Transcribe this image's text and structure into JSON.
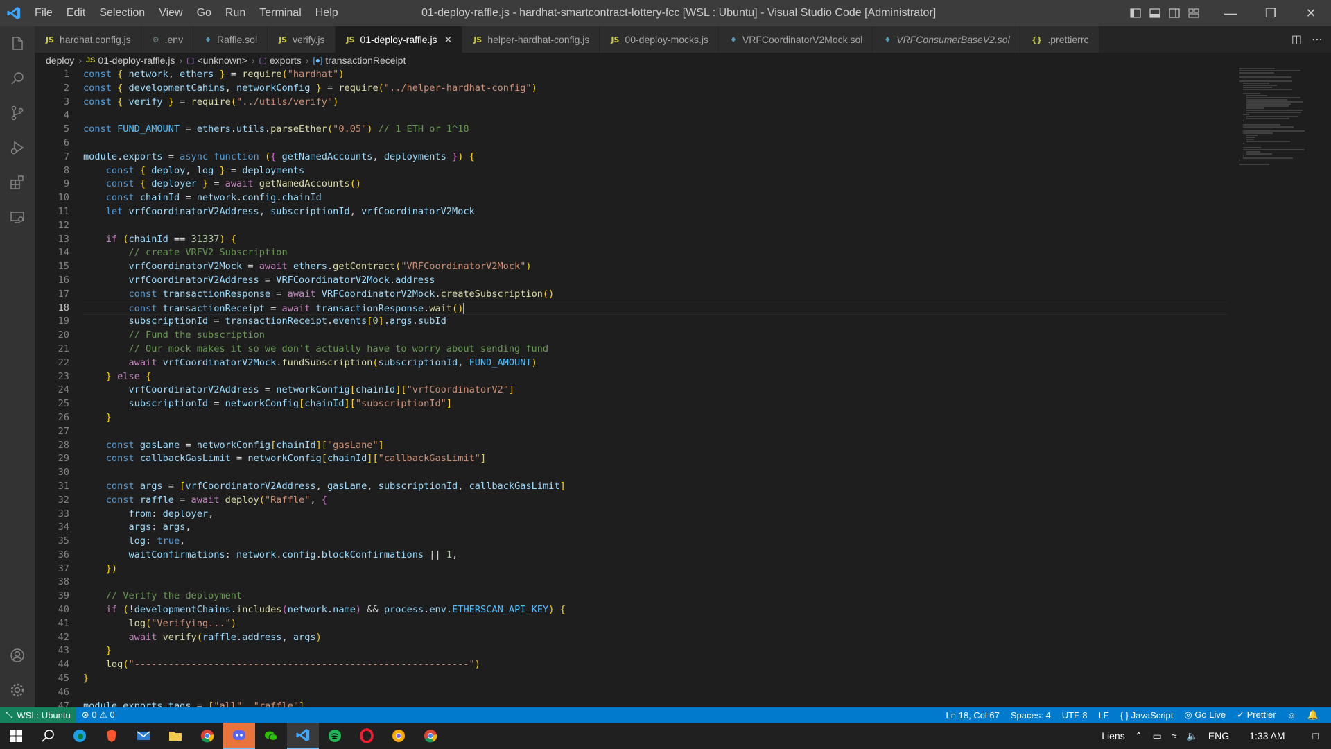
{
  "window": {
    "title": "01-deploy-raffle.js - hardhat-smartcontract-lottery-fcc [WSL : Ubuntu] - Visual Studio Code [Administrator]",
    "menus": [
      "File",
      "Edit",
      "Selection",
      "View",
      "Go",
      "Run",
      "Terminal",
      "Help"
    ]
  },
  "tabs": [
    {
      "icon": "JS",
      "label": "hardhat.config.js",
      "icon_color": "#cbcb41"
    },
    {
      "icon": "⚙",
      "label": ".env",
      "icon_color": "#6d8086"
    },
    {
      "icon": "♦",
      "label": "Raffle.sol",
      "icon_color": "#519aba"
    },
    {
      "icon": "JS",
      "label": "verify.js",
      "icon_color": "#cbcb41"
    },
    {
      "icon": "JS",
      "label": "01-deploy-raffle.js",
      "icon_color": "#cbcb41",
      "active": true
    },
    {
      "icon": "JS",
      "label": "helper-hardhat-config.js",
      "icon_color": "#cbcb41"
    },
    {
      "icon": "JS",
      "label": "00-deploy-mocks.js",
      "icon_color": "#cbcb41"
    },
    {
      "icon": "♦",
      "label": "VRFCoordinatorV2Mock.sol",
      "icon_color": "#519aba"
    },
    {
      "icon": "♦",
      "label": "VRFConsumerBaseV2.sol",
      "icon_color": "#519aba",
      "italic": true
    },
    {
      "icon": "{}",
      "label": ".prettierrc",
      "icon_color": "#cbcb41"
    }
  ],
  "breadcrumb": [
    "deploy",
    "01-deploy-raffle.js",
    "<unknown>",
    "exports",
    "transactionReceipt"
  ],
  "editor": {
    "active_line": 18,
    "lines": [
      "const { network, ethers } = require(\"hardhat\")",
      "const { developmentCahins, networkConfig } = require(\"../helper-hardhat-config\")",
      "const { verify } = require(\"../utils/verify\")",
      "",
      "const FUND_AMOUNT = ethers.utils.parseEther(\"0.05\") // 1 ETH or 1^18",
      "",
      "module.exports = async function ({ getNamedAccounts, deployments }) {",
      "    const { deploy, log } = deployments",
      "    const { deployer } = await getNamedAccounts()",
      "    const chainId = network.config.chainId",
      "    let vrfCoordinatorV2Address, subscriptionId, vrfCoordinatorV2Mock",
      "",
      "    if (chainId == 31337) {",
      "        // create VRFV2 Subscription",
      "        vrfCoordinatorV2Mock = await ethers.getContract(\"VRFCoordinatorV2Mock\")",
      "        vrfCoordinatorV2Address = VRFCoordinatorV2Mock.address",
      "        const transactionResponse = await VRFCoordinatorV2Mock.createSubscription()",
      "        const transactionReceipt = await transactionResponse.wait()",
      "        subscriptionId = transactionReceipt.events[0].args.subId",
      "        // Fund the subscription",
      "        // Our mock makes it so we don't actually have to worry about sending fund",
      "        await vrfCoordinatorV2Mock.fundSubscription(subscriptionId, FUND_AMOUNT)",
      "    } else {",
      "        vrfCoordinatorV2Address = networkConfig[chainId][\"vrfCoordinatorV2\"]",
      "        subscriptionId = networkConfig[chainId][\"subscriptionId\"]",
      "    }",
      "",
      "    const gasLane = networkConfig[chainId][\"gasLane\"]",
      "    const callbackGasLimit = networkConfig[chainId][\"callbackGasLimit\"]",
      "",
      "    const args = [vrfCoordinatorV2Address, gasLane, subscriptionId, callbackGasLimit]",
      "    const raffle = await deploy(\"Raffle\", {",
      "        from: deployer,",
      "        args: args,",
      "        log: true,",
      "        waitConfirmations: network.config.blockConfirmations || 1,",
      "    })",
      "",
      "    // Verify the deployment",
      "    if (!developmentChains.includes(network.name) && process.env.ETHERSCAN_API_KEY) {",
      "        log(\"Verifying...\")",
      "        await verify(raffle.address, args)",
      "    }",
      "    log(\"-----------------------------------------------------------\")",
      "}",
      "",
      "module.exports.tags = [\"all\", \"raffle\"]"
    ]
  },
  "statusbar": {
    "remote": "WSL: Ubuntu",
    "problems": "⊗ 0 ⚠ 0",
    "position": "Ln 18, Col 67",
    "spaces": "Spaces: 4",
    "encoding": "UTF-8",
    "eol": "LF",
    "language": "{ } JavaScript",
    "golive": "Go Live",
    "prettier": "✓ Prettier"
  },
  "taskbar": {
    "tray_label": "Liens",
    "lang": "ENG",
    "time": "1:33 AM"
  },
  "colors": {
    "accent": "#007acc",
    "remote": "#16825d"
  }
}
